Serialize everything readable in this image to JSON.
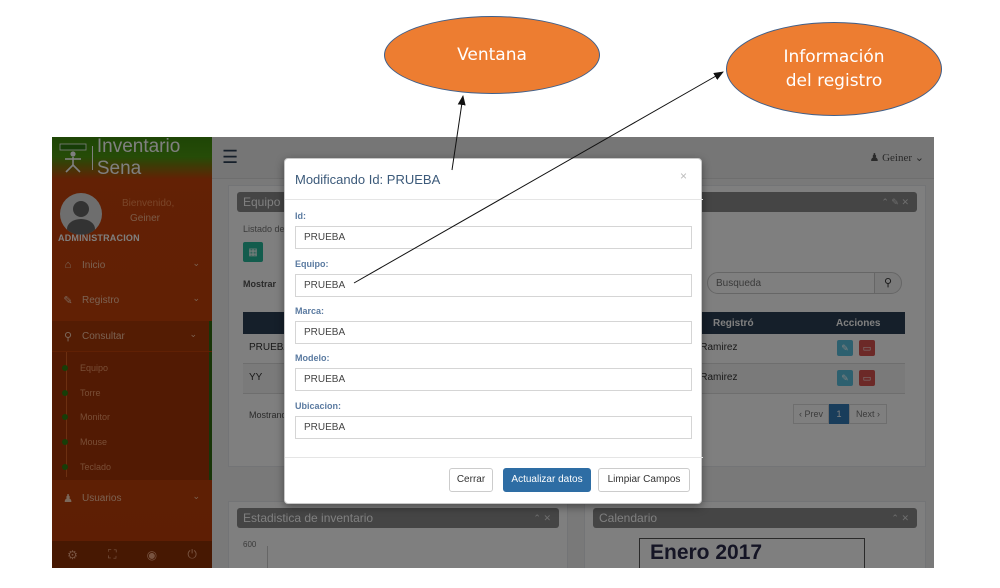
{
  "annotations": {
    "ventana": "Ventana",
    "info_line1": "Información",
    "info_line2": "del registro"
  },
  "colors": {
    "bubble_fill": "#ed7d31",
    "sidebar": "#bb3d08",
    "topbar": "#ededed",
    "primary_button": "#2e6da4",
    "table_header": "#2a3f54"
  },
  "sidebar": {
    "brand": "Inventario Sena",
    "welcome": "Bienvenido,",
    "user": "Geiner",
    "role": "ADMINISTRACION",
    "items": [
      {
        "label": "Inicio",
        "icon": "home-icon"
      },
      {
        "label": "Registro",
        "icon": "edit-icon"
      },
      {
        "label": "Consultar",
        "icon": "search-icon"
      },
      {
        "label": "Usuarios",
        "icon": "users-icon"
      }
    ],
    "subitems": [
      "Equipo",
      "Torre",
      "Monitor",
      "Mouse",
      "Teclado"
    ],
    "footer_icons": [
      "gear-icon",
      "fullscreen-icon",
      "eye-icon",
      "power-icon"
    ]
  },
  "topbar": {
    "user_menu": "Geiner"
  },
  "equipo_panel": {
    "title": "Equipo",
    "subtitle": "Listado de",
    "show_label": "Mostrar",
    "search_placeholder": "Busqueda",
    "columns": {
      "registro": "Registró",
      "acciones": "Acciones"
    },
    "rows": [
      {
        "id": "PRUEBA",
        "registro": "ner Ramirez"
      },
      {
        "id": "YY",
        "registro": "ner Ramirez"
      }
    ],
    "showing": "Mostrand",
    "pagination": {
      "prev": "‹ Prev",
      "current": "1",
      "next": "Next ›"
    }
  },
  "estadistica_panel": {
    "title": "Estadistica de inventario"
  },
  "calendario_panel": {
    "title": "Calendario",
    "month": "Enero 2017"
  },
  "modal": {
    "title": "Modificando Id: PRUEBA",
    "close": "×",
    "fields": [
      {
        "label": "Id:",
        "value": "PRUEBA"
      },
      {
        "label": "Equipo:",
        "value": "PRUEBA"
      },
      {
        "label": "Marca:",
        "value": "PRUEBA"
      },
      {
        "label": "Modelo:",
        "value": "PRUEBA"
      },
      {
        "label": "Ubicacion:",
        "value": "PRUEBA"
      }
    ],
    "buttons": {
      "close": "Cerrar",
      "update": "Actualizar datos",
      "clear": "Limpiar Campos"
    }
  }
}
